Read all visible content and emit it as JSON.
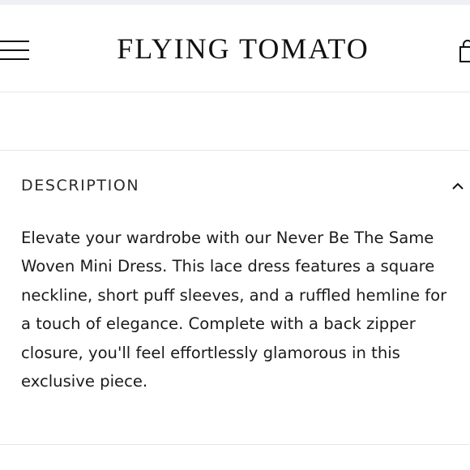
{
  "header": {
    "brand": "FLYING TOMATO",
    "menu_icon": "hamburger-menu-icon",
    "cart_icon": "shopping-bag-icon"
  },
  "description": {
    "title": "DESCRIPTION",
    "toggle_icon": "chevron-up-icon",
    "expanded": true,
    "text": "Elevate your wardrobe with our Never Be The Same Woven Mini Dress. This lace dress features a square neckline, short puff sleeves, and a ruffled hemline for a touch of elegance. Complete with a back zipper closure, you'll feel effortlessly glamorous in this exclusive piece."
  },
  "colors": {
    "text": "#1b1b1b",
    "divider": "#e6e6e6",
    "background": "#ffffff"
  }
}
